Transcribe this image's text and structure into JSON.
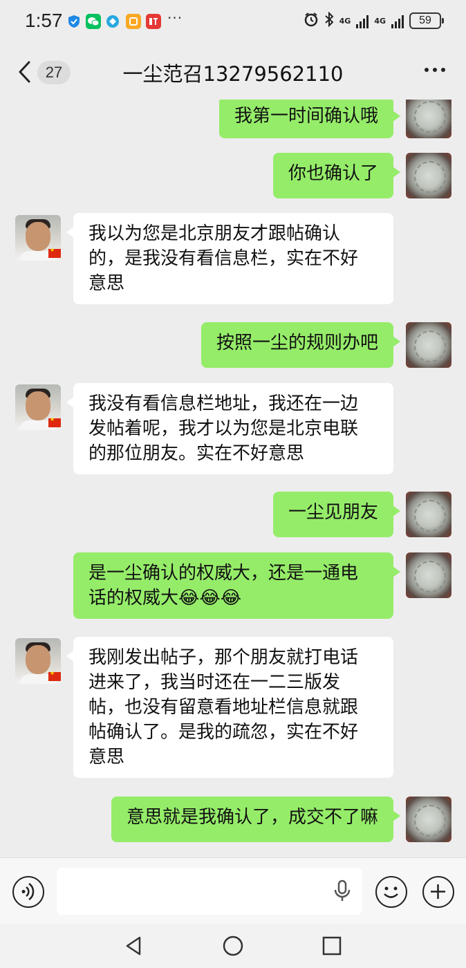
{
  "status_bar": {
    "time": "1:57",
    "more_notifications": "···",
    "signal_1": "4G",
    "signal_2": "4G",
    "battery": "59",
    "notification_icons": [
      "shield-icon",
      "wechat-icon",
      "browser-icon",
      "mi-icon",
      "ting-icon"
    ]
  },
  "nav": {
    "unread_count": "27",
    "title": "一尘范召13279562110"
  },
  "messages": [
    {
      "side": "sent",
      "lines": [
        "我第一时间确认哦"
      ]
    },
    {
      "side": "sent",
      "lines": [
        "你也确认了"
      ]
    },
    {
      "side": "recv",
      "lines": [
        "我以为您是北京朋友才跟帖确认",
        "的，是我没有看信息栏，实在不好",
        "意思"
      ]
    },
    {
      "side": "sent",
      "lines": [
        "按照一尘的规则办吧"
      ]
    },
    {
      "side": "recv",
      "lines": [
        "我没有看信息栏地址，我还在一边",
        "发帖着呢，我才以为您是北京电联",
        "的那位朋友。实在不好意思"
      ]
    },
    {
      "side": "sent",
      "lines": [
        "一尘见朋友"
      ]
    },
    {
      "side": "sent",
      "lines": [
        "是一尘确认的权威大，还是一通电",
        "话的权威大😂😂😂"
      ]
    },
    {
      "side": "recv",
      "lines": [
        "我刚发出帖子，那个朋友就打电话",
        "进来了，我当时还在一二三版发",
        "帖，也没有留意看地址栏信息就跟",
        "帖确认了。是我的疏忽，实在不好",
        "意思"
      ]
    },
    {
      "side": "sent",
      "lines": [
        "意思就是我确认了，成交不了嘛"
      ]
    }
  ],
  "input": {
    "value": "",
    "placeholder": ""
  }
}
